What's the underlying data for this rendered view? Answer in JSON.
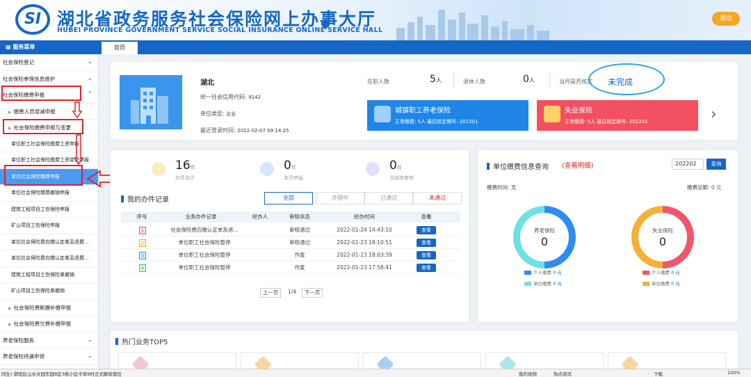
{
  "header": {
    "logo_text": "SI",
    "title": "湖北省政务服务社会保险网上办事大厅",
    "subtitle": "HUBEI PROVINCE GOVERNMENT SERVICE SOCIAL INSURANCE ONLINE SERVICE HALL",
    "exit_label": "退出"
  },
  "menu_bar": {
    "title": "服务菜单"
  },
  "tabs": [
    {
      "label": "首页"
    }
  ],
  "sidebar": {
    "items": [
      {
        "label": "社会保险登记",
        "level": 0,
        "chevron": "⌄"
      },
      {
        "label": "社会保险参保信息维护",
        "level": 0,
        "chevron": "⌄"
      },
      {
        "label": "社会保险缴费申报",
        "level": 0,
        "chevron": "⌃"
      },
      {
        "label": "缴费人员增减申报",
        "level": 1
      },
      {
        "label": "社会保险缴费申报与变更",
        "level": 1
      },
      {
        "label": "单位职工社会保险缴费工资申报",
        "level": 2
      },
      {
        "label": "单位职工社会保险缴费工资变更申报",
        "level": 2
      },
      {
        "label": "单位社会保险缴费申报",
        "level": 2,
        "active": true
      },
      {
        "label": "单位社会保险缴费撤销申报",
        "level": 2
      },
      {
        "label": "建筑工程项目工伤保险申报",
        "level": 2
      },
      {
        "label": "矿山项目工伤保险申报",
        "level": 2
      },
      {
        "label": "单位社会保险费应缴认定单及退费...",
        "level": 2
      },
      {
        "label": "单位社会保险费应缴认定单及退费...",
        "level": 2
      },
      {
        "label": "建筑工程项目工伤保险单撤销",
        "level": 2
      },
      {
        "label": "矿山项目工伤保险单撤销",
        "level": 2
      },
      {
        "label": "社会保险费断缴补缴申报",
        "level": 1
      },
      {
        "label": "社会保险费欠费补缴申报",
        "level": 1
      },
      {
        "label": "养老保险服务",
        "level": 0,
        "chevron": "⌄"
      },
      {
        "label": "养老保险待遇申领",
        "level": 0,
        "chevron": "⌄"
      }
    ]
  },
  "org": {
    "name": "湖北",
    "credit_code_label": "统一社会信用代码:",
    "credit_code_value": "9142",
    "unit_type_label": "单位类型:",
    "unit_type_value": "企业",
    "last_login_label": "最近登录时间:",
    "last_login_value": "2022-02-07 09:14:25"
  },
  "stats": {
    "employed_label": "在职人数",
    "employed_value": "5",
    "employed_unit": "人",
    "retired_label": "退休人数",
    "retired_value": "0",
    "retired_unit": "人",
    "verify_label": "当月是否核定",
    "verify_value": "未完成"
  },
  "insurance_cards": [
    {
      "title": "城镇职工养老保险",
      "detail": "正常缴费: 5人  最后核定期号: 202201",
      "color": "#1f86e8"
    },
    {
      "title": "失业保险",
      "detail": "正常缴费: 5人  最后核定期号: 202201",
      "color": "#f25060"
    }
  ],
  "summary": [
    {
      "value": "16",
      "unit": "件",
      "label": "办件合计",
      "color": "#f5b73b"
    },
    {
      "value": "0",
      "unit": "件",
      "label": "本月申报",
      "color": "#2f8cf0"
    },
    {
      "value": "0",
      "unit": "件",
      "label": "当前待审核",
      "color": "#8b6df0"
    }
  ],
  "records": {
    "title": "我的办件记录",
    "filters": [
      "全部",
      "办理中",
      "已通过",
      "未通过"
    ],
    "headers": [
      "序号",
      "业务办件记录",
      "经办人",
      "审核状态",
      "经办时间",
      "查看"
    ],
    "rows": [
      {
        "no": "1",
        "name": "社会保险费应缴认定单及退...",
        "operator": "",
        "status": "审核通过",
        "time": "2022-01-24 14:43:10",
        "action": "查看",
        "color": "#e8505b"
      },
      {
        "no": "2",
        "name": "单位职工社会保险暂停",
        "operator": "",
        "status": "审核通过",
        "time": "2022-01-23 18:10:51",
        "action": "查看",
        "color": "#f5a623"
      },
      {
        "no": "3",
        "name": "单位职工社会保险暂停",
        "operator": "",
        "status": "作废",
        "time": "2022-01-23 18:03:39",
        "action": "查看",
        "color": "#2f8cf0"
      },
      {
        "no": "4",
        "name": "单位职工社会保险暂停",
        "operator": "",
        "status": "作废",
        "time": "2022-01-23 17:58:41",
        "action": "查看",
        "color": "#3dbb5f"
      }
    ],
    "pagination": {
      "prev": "上一页",
      "page": "1/4",
      "next": "下一页"
    }
  },
  "payment": {
    "title": "单位缴费信息查询",
    "detail_link": "(查看明细)",
    "time_label": "缴费时间:",
    "time_value": "无",
    "total_label": "缴费总额:",
    "total_value": "0 元",
    "year_input": "202202",
    "query_label": "查询",
    "donuts": [
      {
        "title": "养老保险",
        "value": "0",
        "color_a": "#2f8cf0",
        "color_b": "#6fe0e6",
        "legend": [
          {
            "label": "个人缴费",
            "amount": "0 元",
            "color": "#2f8cf0"
          },
          {
            "label": "单位缴费",
            "amount": "0 元",
            "color": "#6fe0e6"
          }
        ]
      },
      {
        "title": "失业保险",
        "value": "0",
        "color_a": "#f2566a",
        "color_b": "#f5b133",
        "legend": [
          {
            "label": "个人缴费",
            "amount": "0 元",
            "color": "#f2566a"
          },
          {
            "label": "单位缴费",
            "amount": "0 元",
            "color": "#f5b133"
          }
        ]
      }
    ]
  },
  "hot": {
    "title": "热门业务TOP5",
    "colors": [
      "#f4c7cf",
      "#f6d7a0",
      "#a7cff4",
      "#a8e6ea",
      "#f6d7a0"
    ]
  },
  "statusbar": {
    "left": "同生)  鄂阳区山水文园东园8区3栋小区今早8时正式解除管控",
    "items": [
      "我的视频",
      "热点资讯",
      "下载",
      "100%"
    ]
  }
}
